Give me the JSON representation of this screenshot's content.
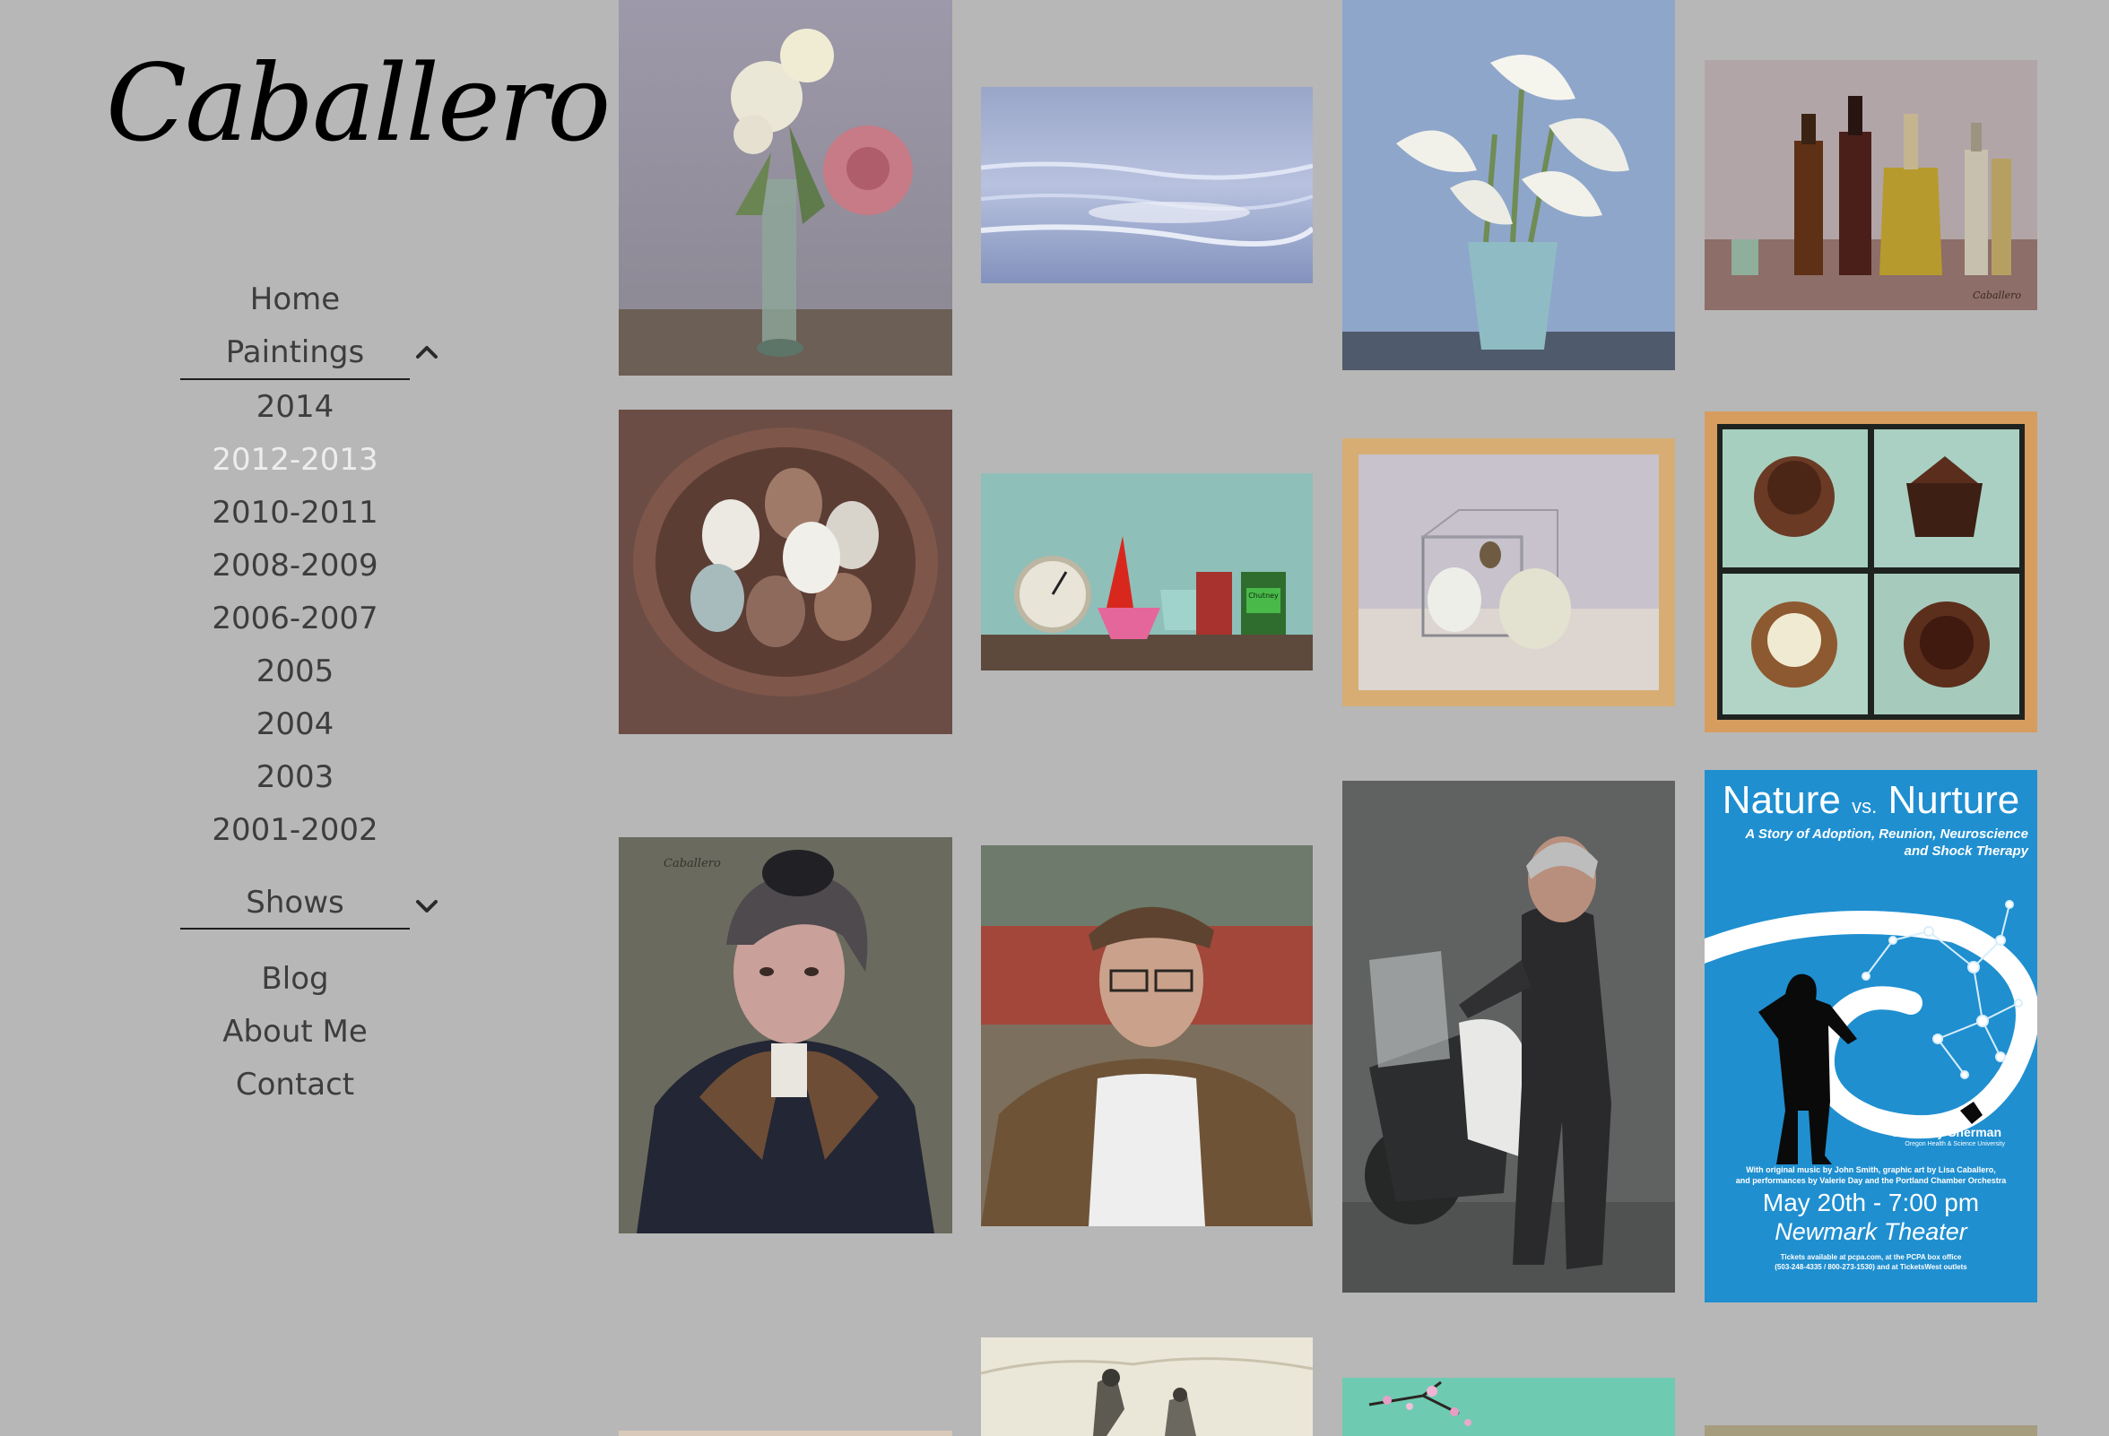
{
  "site": {
    "logo_text": "Caballero"
  },
  "nav": {
    "home": "Home",
    "paintings": "Paintings",
    "years": [
      "2014",
      "2012-2013",
      "2010-2011",
      "2008-2009",
      "2006-2007",
      "2005",
      "2004",
      "2003",
      "2001-2002"
    ],
    "current_year": "2012-2013",
    "shows": "Shows",
    "blog": "Blog",
    "about": "About Me",
    "contact": "Contact"
  },
  "poster": {
    "title_left": "Nature",
    "title_vs": "vs.",
    "title_right": "Nurture",
    "subtitle_line1": "A Story of Adoption, Reunion, Neuroscience",
    "subtitle_line2": "and Shock Therapy",
    "presenter": "Dr. Larry Sherman",
    "presenter_affil": "Oregon Health & Science University",
    "credits_line1": "With original music by John Smith, graphic art by Lisa Caballero,",
    "credits_line2": "and performances by Valerie Day and the Portland Chamber Orchestra",
    "date": "May 20th - 7:00 pm",
    "venue": "Newmark Theater",
    "tickets_line1": "Tickets available at pcpa.com, at the PCPA box office",
    "tickets_line2": "(503-248-4335 / 800-273-1530) and at TicketsWest outlets"
  },
  "painting_signature": "Caballero",
  "jar_label": "Chutney",
  "colors": {
    "background": "#b7b7b7",
    "nav_text": "#3d3d3d",
    "nav_current": "#ededed",
    "poster_blue": "#1f8fd0"
  }
}
